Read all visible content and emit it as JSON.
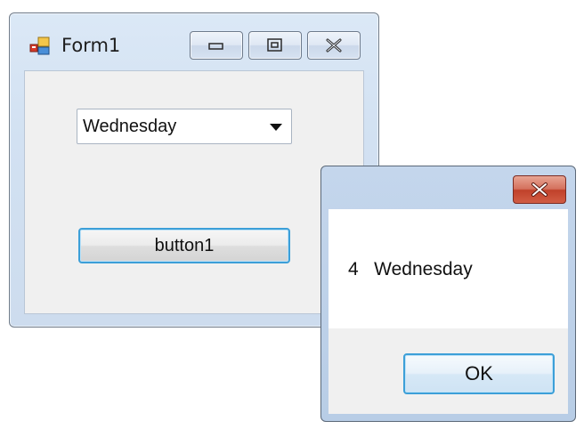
{
  "form1": {
    "title": "Form1",
    "icon": "app-icon",
    "caption_buttons": [
      "minimize-icon",
      "maximize-icon",
      "close-icon"
    ],
    "combobox": {
      "selected_value": "Wednesday"
    },
    "button1_label": "button1"
  },
  "messagebox": {
    "message": "4   Wednesday",
    "ok_label": "OK"
  },
  "colors": {
    "frame_blue": "#cddcee",
    "focus_border": "#3c9fd8",
    "close_red": "#c0412a",
    "client_bg": "#f0f0f0"
  }
}
